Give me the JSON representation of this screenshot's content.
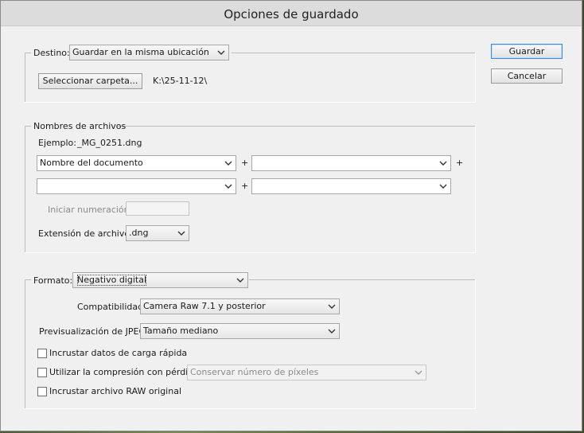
{
  "dialog": {
    "title": "Opciones de guardado"
  },
  "actions": {
    "save": "Guardar",
    "cancel": "Cancelar"
  },
  "destination": {
    "label": "Destino:",
    "selected": "Guardar en la misma ubicación",
    "choose_button": "Seleccionar carpeta...",
    "path": "K:\\25-11-12\\"
  },
  "filenames": {
    "group_label": "Nombres de archivos",
    "example_label": "Ejemplo:",
    "example_value": "_MG_0251.dng",
    "plus": "+",
    "field1": "Nombre del documento",
    "field2": "",
    "field3": "",
    "field4": "",
    "numbering_label": "Iniciar numeración:",
    "numbering_value": "",
    "extension_label": "Extensión de archivo:",
    "extension_value": ".dng"
  },
  "format": {
    "label": "Formato:",
    "selected": "Negativo digital",
    "compat_label": "Compatibilidad:",
    "compat_value": "Camera Raw 7.1 y posterior",
    "preview_label": "Previsualización de JPEG:",
    "preview_value": "Tamaño mediano",
    "opt_fastload": "Incrustar datos de carga rápida",
    "opt_lossy": "Utilizar la compresión con pérdida:",
    "lossy_value": "Conservar número de píxeles",
    "opt_embed_raw": "Incrustar archivo RAW original"
  }
}
